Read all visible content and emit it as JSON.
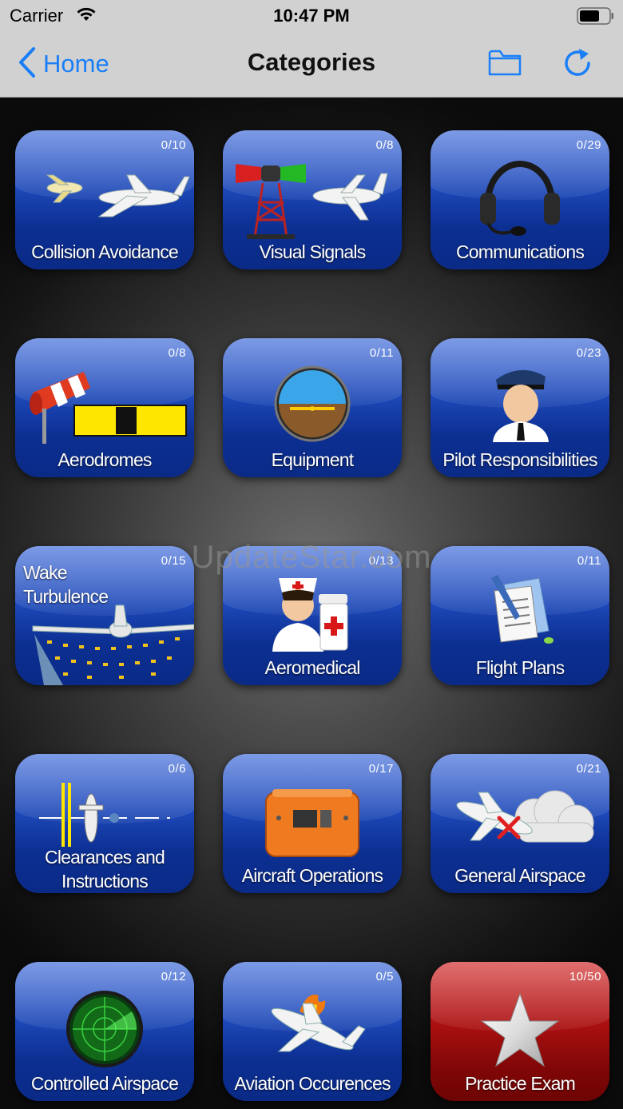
{
  "status_bar": {
    "carrier": "Carrier",
    "time": "10:47 PM"
  },
  "nav": {
    "back_label": "Home",
    "title": "Categories"
  },
  "watermark": "UpdateStar.com",
  "categories": [
    {
      "label": "Collision Avoidance",
      "count": "0/10",
      "icon": "planes-icon"
    },
    {
      "label": "Visual Signals",
      "count": "0/8",
      "icon": "signal-tower-icon"
    },
    {
      "label": "Communications",
      "count": "0/29",
      "icon": "headset-icon"
    },
    {
      "label": "Aerodromes",
      "count": "0/8",
      "icon": "windsock-icon"
    },
    {
      "label": "Equipment",
      "count": "0/11",
      "icon": "attitude-indicator-icon"
    },
    {
      "label": "Pilot Responsibilities",
      "count": "0/23",
      "icon": "pilot-icon"
    },
    {
      "label_line1": "Wake",
      "label_line2": "Turbulence",
      "count": "0/15",
      "icon": "wake-turbulence-icon"
    },
    {
      "label": "Aeromedical",
      "count": "0/13",
      "icon": "nurse-icon"
    },
    {
      "label": "Flight Plans",
      "count": "0/11",
      "icon": "documents-icon"
    },
    {
      "label_line1": "Clearances and",
      "label_line2": "Instructions",
      "count": "0/6",
      "icon": "runway-plane-icon"
    },
    {
      "label": "Aircraft Operations",
      "count": "0/17",
      "icon": "flight-recorder-icon"
    },
    {
      "label": "General Airspace",
      "count": "0/21",
      "icon": "plane-cloud-icon"
    },
    {
      "label": "Controlled Airspace",
      "count": "0/12",
      "icon": "radar-icon"
    },
    {
      "label": "Aviation Occurences",
      "count": "0/5",
      "icon": "burning-plane-icon"
    },
    {
      "label": "Practice Exam",
      "count": "10/50",
      "icon": "star-icon"
    }
  ],
  "colors": {
    "tile_blue": "#1d48b8",
    "tile_red": "#ab1010",
    "accent": "#1a7ff7"
  }
}
